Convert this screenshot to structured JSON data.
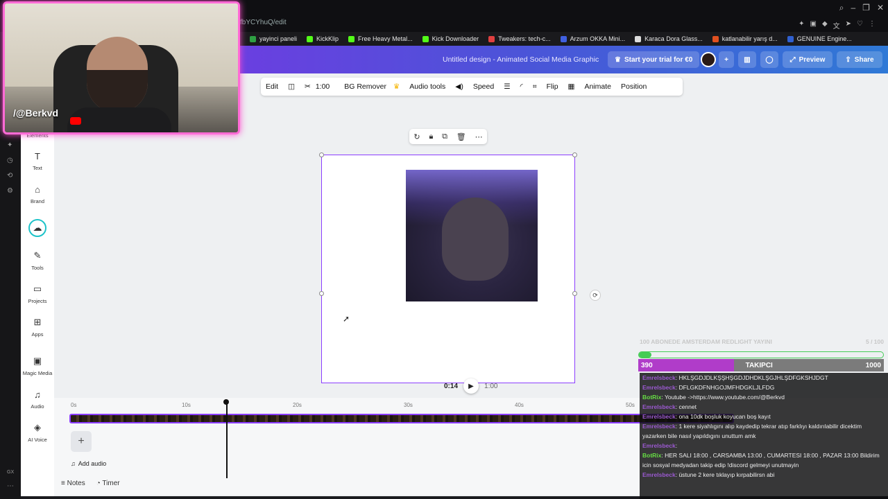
{
  "browser": {
    "url": "fbYCYhuQ/edit",
    "bookmarks": [
      "yayinci paneli",
      "KickKlip",
      "Free Heavy Metal...",
      "Kick Downloader",
      "Tweakers: tech-c...",
      "Arzum OKKA Mini...",
      "Karaca Dora Glass...",
      "katlanabilir yarış d...",
      "GENUINE Engine..."
    ],
    "bookmark_colors": [
      "#2ea043",
      "#53fc18",
      "#53fc18",
      "#53fc18",
      "#e04040",
      "#4060e0",
      "#dddddd",
      "#e05020",
      "#3060d0"
    ]
  },
  "header": {
    "doc_title": "Untitled design - Animated Social Media Graphic",
    "trial_label": "Start your trial for €0",
    "preview_label": "Preview",
    "share_label": "Share"
  },
  "sidenav": {
    "elements_label": "Elements",
    "items": [
      {
        "label": "Text",
        "icon": "text-icon"
      },
      {
        "label": "Brand",
        "icon": "crown-brand-icon"
      },
      {
        "label": "",
        "icon": "upload-cloud-icon"
      },
      {
        "label": "Tools",
        "icon": "pencil-icon"
      },
      {
        "label": "Projects",
        "icon": "folder-icon"
      },
      {
        "label": "Apps",
        "icon": "apps-grid-icon"
      },
      {
        "label": "Magic Media",
        "icon": "image-magic-icon"
      },
      {
        "label": "Audio",
        "icon": "music-icon"
      },
      {
        "label": "AI Voice",
        "icon": "ai-voice-icon"
      }
    ]
  },
  "toolbar": {
    "edit": "Edit",
    "duration": "1:00",
    "bg_remover": "BG Remover",
    "audio_tools": "Audio tools",
    "speed": "Speed",
    "flip": "Flip",
    "animate": "Animate",
    "position": "Position"
  },
  "playback": {
    "current": "0:14",
    "total": "1:00"
  },
  "timeline": {
    "ticks": [
      "0s",
      "10s",
      "20s",
      "30s",
      "40s",
      "50s"
    ],
    "add_audio": "Add audio",
    "notes": "Notes",
    "timer": "Timer"
  },
  "webcam": {
    "handle": "/@Berkvd"
  },
  "stream_overlay": {
    "goal_title": "100 ABONEDE AMSTERDAM REDLIGHT YAYINI",
    "goal_count": "5 / 100",
    "goal_progress": 0.05,
    "follow_current": "390",
    "follow_label": "TAKIPCI",
    "follow_target": "1000",
    "follow_progress": 0.39,
    "chat": [
      {
        "user": "Emrelsbeck",
        "text": ": HKLŞGDJDLKŞŞHŞGDJDHDKLŞGJHLŞDFGKSHJDGT",
        "color": "#9b59d0"
      },
      {
        "user": "Emrelsbeck",
        "text": ": DFLGKDFNHGOJMFHDGKLJLFDG",
        "color": "#9b59d0"
      },
      {
        "user": "BotRix",
        "text": ": Youtube ->https://www.youtube.com/@Berkvd",
        "color": "#66dd44"
      },
      {
        "user": "Emrelsbeck",
        "text": ": cennet",
        "color": "#9b59d0"
      },
      {
        "user": "Emrelsbeck",
        "text": ": ona 10dk boşluk koyucan boş kayıt",
        "color": "#9b59d0"
      },
      {
        "user": "Emrelsbeck",
        "text": ": 1 kere siyahlıgını alıp kaydedip tekrar atıp farklıyı kaldırılabilir dicektim yazarken bile nasıl yapıldıgını unuttum amk",
        "color": "#9b59d0"
      },
      {
        "user": "Emrelsbeck",
        "text": ":",
        "color": "#9b59d0"
      },
      {
        "user": "BotRix",
        "text": ": HER SALI 18:00 , CARSAMBA 13:00 , CUMARTESI 18:00 , PAZAR 13:00 Bildirim icin sosyal medyadan takip edip !discord gelmeyi unutmayin",
        "color": "#66dd44"
      },
      {
        "user": "Emrelsbeck",
        "text": ": üstune 2 kere tıklayıp kırpabilirsn abi",
        "color": "#9b59d0"
      }
    ]
  }
}
